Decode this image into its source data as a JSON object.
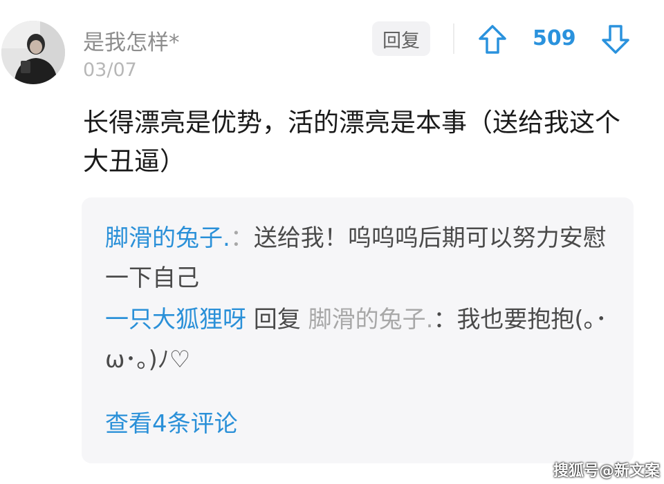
{
  "comment": {
    "username": "是我怎样*",
    "date": "03/07",
    "reply_label": "回复",
    "vote_count": "509",
    "text": "长得漂亮是优势，活的漂亮是本事（送给我这个大丑逼）"
  },
  "replies": [
    {
      "author": "脚滑的兔子.",
      "sep": "：",
      "text": "送给我！呜呜呜后期可以努力安慰一下自己"
    },
    {
      "author": "一只大狐狸呀",
      "reply_word": " 回复 ",
      "target": "脚滑的兔子.",
      "sep": "：",
      "text": "我也要抱抱(｡･ω･｡)ﾉ♡"
    }
  ],
  "view_more": "查看4条评论",
  "watermark": "搜狐号@新文案",
  "icons": {
    "upvote": "arrow-up-icon",
    "downvote": "arrow-down-icon"
  },
  "colors": {
    "accent": "#2a90d8",
    "vote": "#2a92dd"
  }
}
